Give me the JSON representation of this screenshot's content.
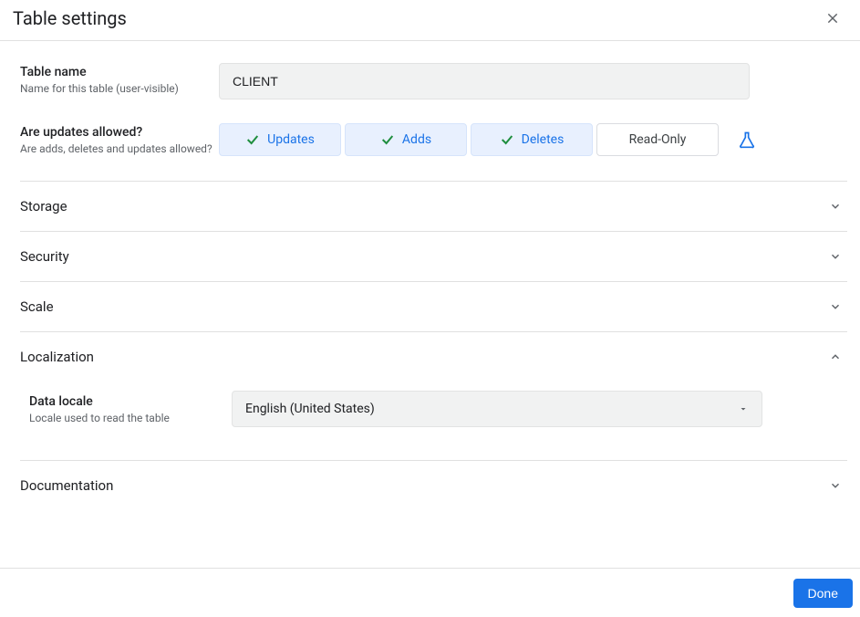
{
  "dialog": {
    "title": "Table settings"
  },
  "tableName": {
    "label": "Table name",
    "help": "Name for this table (user-visible)",
    "value": "CLIENT"
  },
  "updates": {
    "label": "Are updates allowed?",
    "help": "Are adds, deletes and updates allowed?",
    "options": {
      "updates": "Updates",
      "adds": "Adds",
      "deletes": "Deletes",
      "readonly": "Read-Only"
    }
  },
  "sections": {
    "storage": "Storage",
    "security": "Security",
    "scale": "Scale",
    "localization": "Localization",
    "documentation": "Documentation"
  },
  "localization": {
    "dataLocale": {
      "label": "Data locale",
      "help": "Locale used to read the table",
      "value": "English (United States)"
    }
  },
  "footer": {
    "done": "Done"
  }
}
